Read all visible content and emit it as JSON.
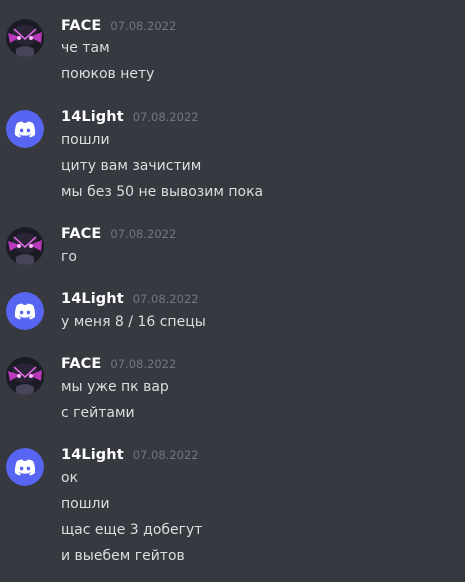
{
  "messages": [
    {
      "author": "FACE",
      "avatar_icon": "face-avatar-icon",
      "timestamp": "07.08.2022",
      "lines": [
        "че там",
        "поюков нету"
      ]
    },
    {
      "author": "14Light",
      "avatar_icon": "discord-logo-icon",
      "timestamp": "07.08.2022",
      "lines": [
        "пошли",
        "циту вам зачистим",
        "мы без 50 не вывозим пока"
      ]
    },
    {
      "author": "FACE",
      "avatar_icon": "face-avatar-icon",
      "timestamp": "07.08.2022",
      "lines": [
        "го"
      ]
    },
    {
      "author": "14Light",
      "avatar_icon": "discord-logo-icon",
      "timestamp": "07.08.2022",
      "lines": [
        "у меня 8 / 16 спецы"
      ]
    },
    {
      "author": "FACE",
      "avatar_icon": "face-avatar-icon",
      "timestamp": "07.08.2022",
      "lines": [
        "мы уже пк вар",
        "с гейтами"
      ]
    },
    {
      "author": "14Light",
      "avatar_icon": "discord-logo-icon",
      "timestamp": "07.08.2022",
      "lines": [
        "ок",
        "пошли",
        "щас еще 3 добегут",
        "и выебем гейтов"
      ]
    }
  ],
  "colors": {
    "background": "#36393f",
    "username": "#ffffff",
    "timestamp": "#72767d",
    "message_text": "#dcddde",
    "discord_blurple": "#5865f2",
    "face_avatar_bg": "#1b1b24",
    "face_avatar_accent": "#d63dd6"
  }
}
